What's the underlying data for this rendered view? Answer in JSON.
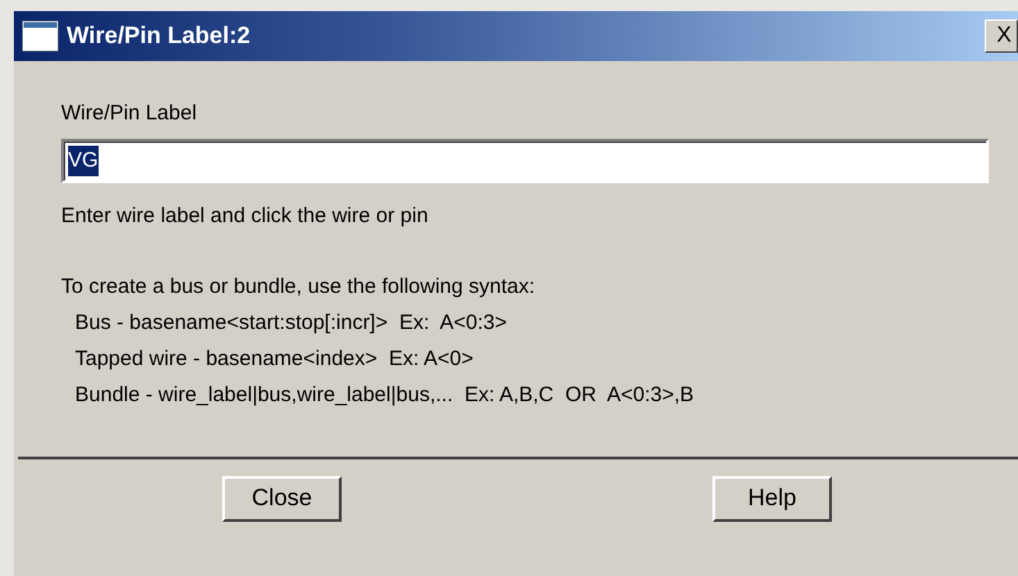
{
  "window": {
    "title": "Wire/Pin Label:2",
    "close": "X"
  },
  "field": {
    "label": "Wire/Pin Label",
    "value": "VG",
    "value_selected": true
  },
  "hint": "Enter wire label and click the wire or pin",
  "syntax": {
    "heading": "To create a bus or bundle, use the following syntax:",
    "lines": [
      "Bus - basename<start:stop[:incr]>  Ex:  A<0:3>",
      "Tapped wire - basename<index>  Ex: A<0>",
      "Bundle - wire_label|bus,wire_label|bus,...  Ex: A,B,C  OR  A<0:3>,B"
    ]
  },
  "buttons": [
    "Close",
    "Help"
  ]
}
